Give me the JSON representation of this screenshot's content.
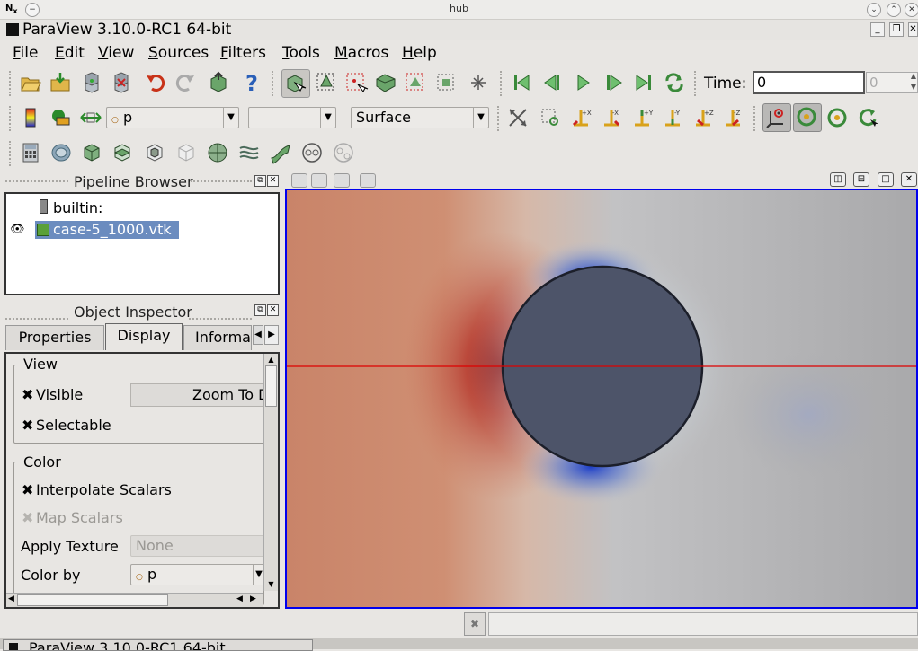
{
  "system_bar": {
    "title": "hub"
  },
  "window": {
    "title": "ParaView 3.10.0-RC1 64-bit"
  },
  "menu": [
    {
      "label": "File",
      "underline": "F",
      "rest": "ile"
    },
    {
      "label": "Edit",
      "underline": "E",
      "rest": "dit"
    },
    {
      "label": "View",
      "underline": "V",
      "rest": "iew"
    },
    {
      "label": "Sources",
      "underline": "S",
      "rest": "ources"
    },
    {
      "label": "Filters",
      "underline": "F",
      "rest": "ilters"
    },
    {
      "label": "Tools",
      "underline": "T",
      "rest": "ools"
    },
    {
      "label": "Macros",
      "underline": "M",
      "rest": "acros"
    },
    {
      "label": "Help",
      "underline": "H",
      "rest": "elp"
    }
  ],
  "time_control": {
    "label": "Time:",
    "value": "0",
    "step_value": "0"
  },
  "variable_toolbar": {
    "array": "p",
    "component": "",
    "representation": "Surface"
  },
  "pipeline_browser": {
    "title": "Pipeline Browser",
    "items": [
      {
        "label": "builtin:"
      },
      {
        "label": "case-5_1000.vtk"
      }
    ]
  },
  "object_inspector": {
    "title": "Object Inspector",
    "tabs": [
      "Properties",
      "Display",
      "Informa"
    ],
    "active_tab": "Display",
    "view_group": {
      "title": "View",
      "visible_label": "Visible",
      "visible_checked": true,
      "selectable_label": "Selectable",
      "selectable_checked": true,
      "zoom_button": "Zoom To Data"
    },
    "color_group": {
      "title": "Color",
      "interpolate_label": "Interpolate Scalars",
      "interpolate_checked": true,
      "map_scalars_label": "Map Scalars",
      "map_scalars_checked": true,
      "apply_texture_label": "Apply Texture",
      "apply_texture_value": "None",
      "color_by_label": "Color by",
      "color_by_value": "p"
    }
  },
  "taskbar": {
    "label": "ParaView 3.10.0-RC1 64-bit"
  },
  "colors": {
    "view_border": "#0000ee",
    "high_pressure": "#8b0d0d",
    "low_pressure": "#1e3fc8",
    "cylinder": "#4d5469",
    "centerline": "#dd0000",
    "selection": "#6b8cbf"
  }
}
